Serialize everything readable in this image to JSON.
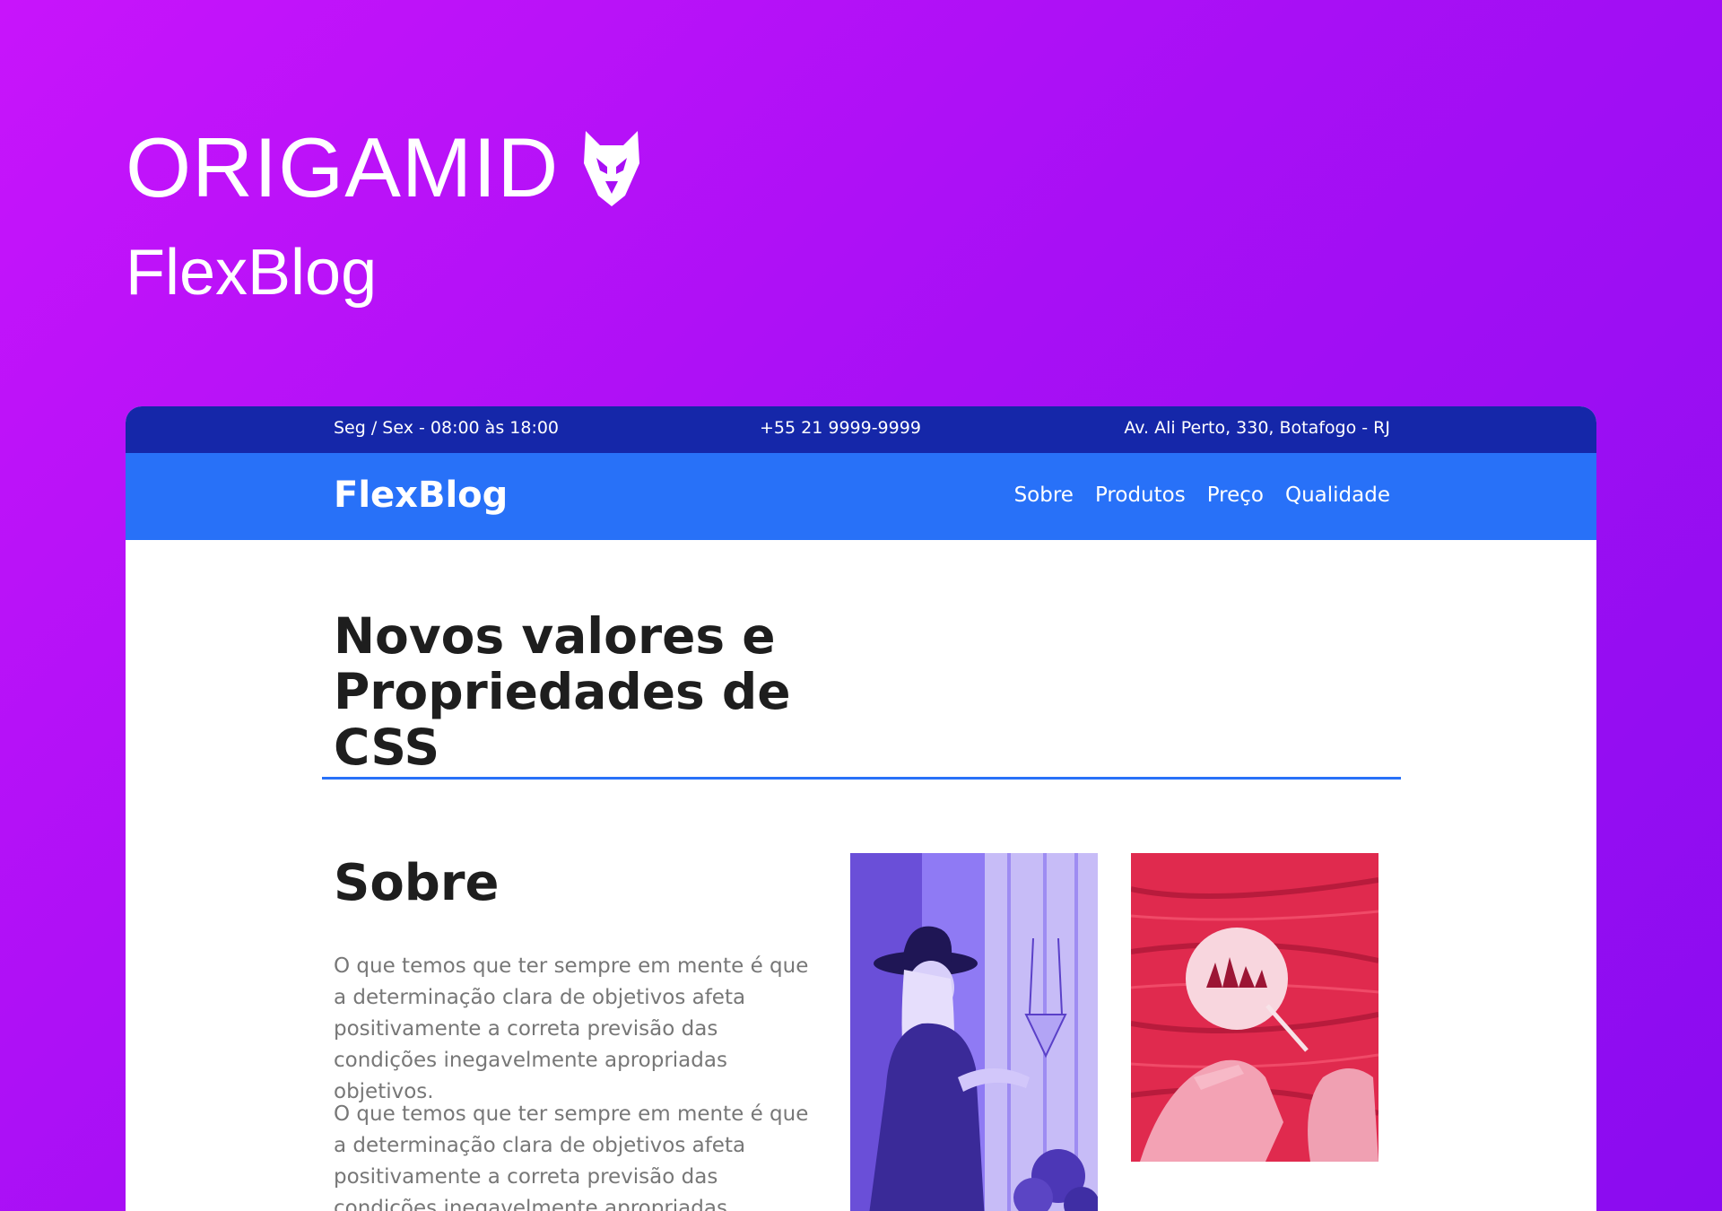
{
  "brand": {
    "logo_text": "ORIGAMID",
    "icon": "fox-head-icon"
  },
  "project": {
    "title": "FlexBlog"
  },
  "site": {
    "topbar": {
      "hours": "Seg / Sex - 08:00 às 18:00",
      "phone": "+55 21 9999-9999",
      "address": "Av. Ali Perto, 330, Botafogo - RJ"
    },
    "nav": {
      "logo": "FlexBlog",
      "links": [
        "Sobre",
        "Produtos",
        "Preço",
        "Qualidade"
      ]
    },
    "hero": {
      "title_line1": "Novos valores e",
      "title_line2": "Propriedades de CSS"
    },
    "about": {
      "title": "Sobre",
      "paragraphs": [
        "O que temos que ter sempre em mente é que a determinação clara de objetivos afeta positivamente a correta previsão das condições inegavelmente apropriadas objetivos.",
        "O que temos que ter sempre em mente é que a determinação clara de objetivos afeta positivamente a correta previsão das condições inegavelmente apropriadas objetivos."
      ]
    },
    "images": [
      {
        "name": "woman-with-hat-photo",
        "tint": "#7b5cf0"
      },
      {
        "name": "hands-painting-photo",
        "tint": "#e8254f"
      }
    ]
  },
  "colors": {
    "background_start": "#c814fb",
    "background_end": "#8a0cf0",
    "topbar": "#1527a9",
    "navbar": "#2871f8",
    "accent": "#2871f8"
  }
}
